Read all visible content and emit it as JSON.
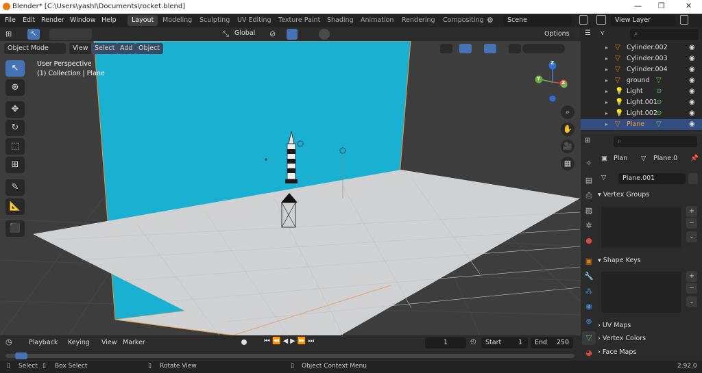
{
  "window": {
    "title": "Blender* [C:\\Users\\yashl\\Documents\\rocket.blend]",
    "minimize": "—",
    "maximize": "❐",
    "close": "✕"
  },
  "menu": [
    "File",
    "Edit",
    "Render",
    "Window",
    "Help"
  ],
  "workspaces": [
    "Layout",
    "Modeling",
    "Sculpting",
    "UV Editing",
    "Texture Paint",
    "Shading",
    "Animation",
    "Rendering",
    "Compositing"
  ],
  "scene": {
    "label": "Scene",
    "view_layer": "View Layer"
  },
  "header": {
    "orientation": "Global",
    "options": "Options"
  },
  "viewport_header": {
    "mode": "Object Mode",
    "view": "View",
    "select": "Select",
    "add": "Add",
    "object": "Object"
  },
  "viewport": {
    "perspective": "User Perspective",
    "collection": "(1) Collection | Plane"
  },
  "gizmo": {
    "z": "Z",
    "y": "Y",
    "x": "X"
  },
  "outliner": [
    {
      "name": "Cylinder.002",
      "icon": "mesh"
    },
    {
      "name": "Cylinder.003",
      "icon": "mesh"
    },
    {
      "name": "Cylinder.004",
      "icon": "mesh"
    },
    {
      "name": "ground",
      "icon": "mesh",
      "extra": "mesh-data"
    },
    {
      "name": "Light",
      "icon": "light",
      "extra": "light-data"
    },
    {
      "name": "Light.001",
      "icon": "light",
      "extra": "light-data"
    },
    {
      "name": "Light.002",
      "icon": "light",
      "extra": "light-data"
    },
    {
      "name": "Plane",
      "icon": "mesh",
      "extra": "mesh-data",
      "selected": true
    }
  ],
  "properties": {
    "object": "Plan",
    "mesh": "Plane.0",
    "data": "Plane.001",
    "sections": [
      "Vertex Groups",
      "Shape Keys",
      "UV Maps",
      "Vertex Colors",
      "Face Maps"
    ]
  },
  "timeline": {
    "playback": "Playback",
    "keying": "Keying",
    "view": "View",
    "marker": "Marker",
    "frame": "1",
    "start_label": "Start",
    "start": "1",
    "end_label": "End",
    "end": "250"
  },
  "status": {
    "select": "Select",
    "box": "Box Select",
    "rotate": "Rotate View",
    "context": "Object Context Menu",
    "version": "2.92.0"
  },
  "colors": {
    "accent": "#4772b3",
    "selection": "#334d80",
    "wall": "#1ab0d2",
    "floor": "#cfd1d3",
    "orange": "#e87d0d"
  }
}
